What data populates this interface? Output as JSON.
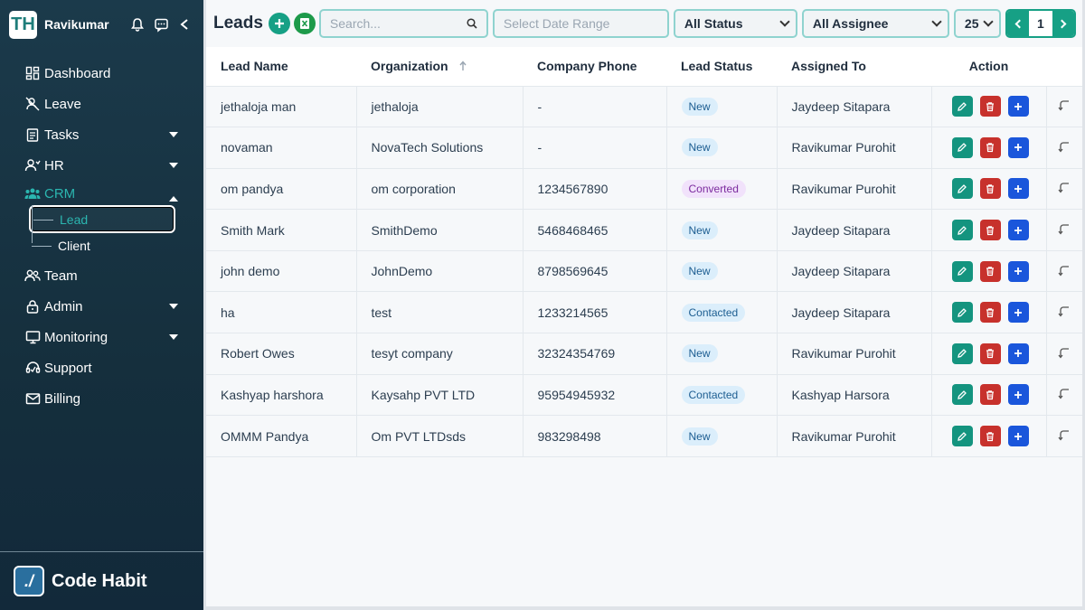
{
  "sidebar": {
    "logo_text": "TH",
    "user_name": "Ravikumar",
    "items": [
      {
        "label": "Dashboard",
        "icon": "dashboard-icon"
      },
      {
        "label": "Leave",
        "icon": "leave-icon"
      },
      {
        "label": "Tasks",
        "icon": "tasks-icon"
      },
      {
        "label": "HR",
        "icon": "hr-icon"
      },
      {
        "label": "CRM",
        "icon": "crm-icon"
      },
      {
        "label": "Team",
        "icon": "team-icon"
      },
      {
        "label": "Admin",
        "icon": "lock-icon"
      },
      {
        "label": "Monitoring",
        "icon": "monitor-icon"
      },
      {
        "label": "Support",
        "icon": "support-icon"
      },
      {
        "label": "Billing",
        "icon": "billing-icon"
      }
    ],
    "crm_sub": [
      {
        "label": "Lead"
      },
      {
        "label": "Client"
      }
    ],
    "footer_brand": "Code Habit"
  },
  "toolbar": {
    "title": "Leads",
    "search_placeholder": "Search...",
    "date_placeholder": "Select Date Range",
    "status_select": "All Status",
    "assignee_select": "All Assignee",
    "page_size": "25",
    "page": "1"
  },
  "table": {
    "headers": [
      "Lead Name",
      "Organization",
      "Company Phone",
      "Lead Status",
      "Assigned To",
      "Action"
    ],
    "rows": [
      {
        "name": "jethaloja man",
        "org": "jethaloja",
        "phone": "-",
        "status": "New",
        "assigned": "Jaydeep Sitapara"
      },
      {
        "name": "novaman",
        "org": "NovaTech Solutions",
        "phone": "-",
        "status": "New",
        "assigned": "Ravikumar Purohit"
      },
      {
        "name": "om pandya",
        "org": "om corporation",
        "phone": "1234567890",
        "status": "Converted",
        "assigned": "Ravikumar Purohit"
      },
      {
        "name": "Smith Mark",
        "org": "SmithDemo",
        "phone": "5468468465",
        "status": "New",
        "assigned": "Jaydeep Sitapara"
      },
      {
        "name": "john demo",
        "org": "JohnDemo",
        "phone": "8798569645",
        "status": "New",
        "assigned": "Jaydeep Sitapara"
      },
      {
        "name": "ha",
        "org": "test",
        "phone": "1233214565",
        "status": "Contacted",
        "assigned": "Jaydeep Sitapara"
      },
      {
        "name": "Robert Owes",
        "org": "tesyt company",
        "phone": "32324354769",
        "status": "New",
        "assigned": "Ravikumar Purohit"
      },
      {
        "name": "Kashyap harshora",
        "org": "Kaysahp PVT LTD",
        "phone": "95954945932",
        "status": "Contacted",
        "assigned": "Kashyap Harsora"
      },
      {
        "name": "OMMM Pandya",
        "org": "Om PVT LTDsds",
        "phone": "983298498",
        "status": "New",
        "assigned": "Ravikumar Purohit"
      }
    ]
  },
  "colors": {
    "sidebar_bg": "#1b3a4b",
    "accent": "#16a085",
    "edit": "#14947f",
    "delete": "#c7312c",
    "add": "#1a56db"
  }
}
